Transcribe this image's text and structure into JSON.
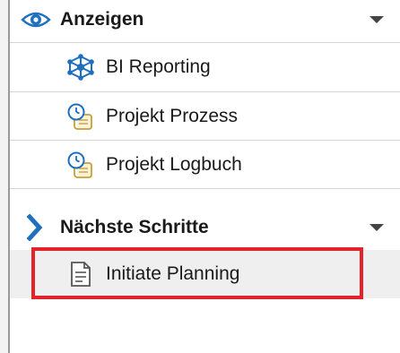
{
  "sections": {
    "anzeigen": {
      "label": "Anzeigen",
      "items": [
        {
          "label": "BI Reporting",
          "icon": "network-cube-icon"
        },
        {
          "label": "Projekt Prozess",
          "icon": "clock-scroll-icon"
        },
        {
          "label": "Projekt Logbuch",
          "icon": "clock-scroll-icon"
        }
      ]
    },
    "naechste_schritte": {
      "label": "Nächste Schritte",
      "items": [
        {
          "label": "Initiate Planning",
          "icon": "document-icon"
        }
      ]
    }
  },
  "colors": {
    "accent_blue": "#1f6fbf",
    "highlight_red": "#e3222a",
    "separator": "#d5d5d5",
    "selected_bg": "#efefef"
  }
}
